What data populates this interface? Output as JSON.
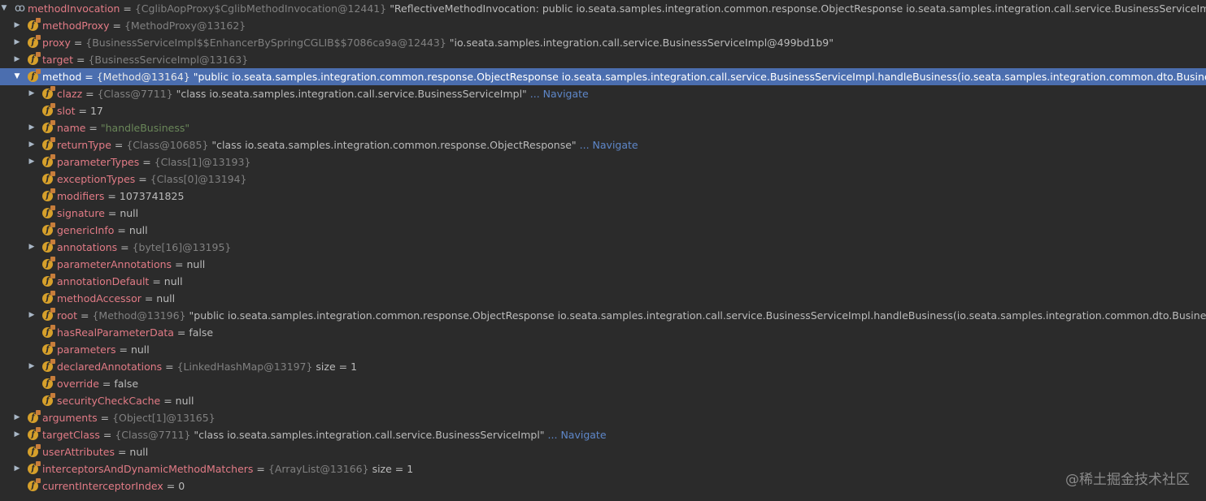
{
  "rows": [
    {
      "level": 0,
      "arrow": "down",
      "icon": "watch",
      "name": "methodInvocation",
      "type": "{CglibAopProxy$CglibMethodInvocation@12441}",
      "value": "\"ReflectiveMethodInvocation: public io.seata.samples.integration.common.response.ObjectResponse io.seata.samples.integration.call.service.BusinessServiceImpl.handleBusiness(io.seata.samples.integration.common.dto.BusinessDTO)\"",
      "nav": ""
    },
    {
      "level": 1,
      "arrow": "right",
      "icon": "field-lock",
      "name": "methodProxy",
      "type": "{MethodProxy@13162}",
      "value": "",
      "nav": ""
    },
    {
      "level": 1,
      "arrow": "right",
      "icon": "field-lock",
      "name": "proxy",
      "type": "{BusinessServiceImpl$$EnhancerBySpringCGLIB$$7086ca9a@12443}",
      "value": "\"io.seata.samples.integration.call.service.BusinessServiceImpl@499bd1b9\"",
      "nav": ""
    },
    {
      "level": 1,
      "arrow": "right",
      "icon": "field-lock",
      "name": "target",
      "type": "{BusinessServiceImpl@13163}",
      "value": "",
      "nav": ""
    },
    {
      "level": 1,
      "arrow": "down",
      "icon": "field-lock",
      "name": "method",
      "type": "{Method@13164}",
      "value": "\"public io.seata.samples.integration.common.response.ObjectResponse io.seata.samples.integration.call.service.BusinessServiceImpl.handleBusiness(io.seata.samples.integration.common.dto.BusinessDTO)\"",
      "nav": "",
      "selected": true
    },
    {
      "level": 2,
      "arrow": "right",
      "icon": "field-lock",
      "name": "clazz",
      "type": "{Class@7711}",
      "value": "\"class io.seata.samples.integration.call.service.BusinessServiceImpl\"",
      "nav": "... Navigate"
    },
    {
      "level": 2,
      "arrow": "",
      "icon": "field-lock",
      "name": "slot",
      "type": "",
      "value": "17",
      "nav": ""
    },
    {
      "level": 2,
      "arrow": "right",
      "icon": "field-lock",
      "name": "name",
      "type": "",
      "value": "",
      "str": "\"handleBusiness\"",
      "nav": ""
    },
    {
      "level": 2,
      "arrow": "right",
      "icon": "field-lock",
      "name": "returnType",
      "type": "{Class@10685}",
      "value": "\"class io.seata.samples.integration.common.response.ObjectResponse\"",
      "nav": "... Navigate"
    },
    {
      "level": 2,
      "arrow": "right",
      "icon": "field-lock",
      "name": "parameterTypes",
      "type": "{Class[1]@13193}",
      "value": "",
      "nav": ""
    },
    {
      "level": 2,
      "arrow": "",
      "icon": "field-lock",
      "name": "exceptionTypes",
      "type": "{Class[0]@13194}",
      "value": "",
      "nav": ""
    },
    {
      "level": 2,
      "arrow": "",
      "icon": "field-lock",
      "name": "modifiers",
      "type": "",
      "value": "1073741825",
      "nav": ""
    },
    {
      "level": 2,
      "arrow": "",
      "icon": "field-lock",
      "name": "signature",
      "type": "",
      "value": "null",
      "nav": ""
    },
    {
      "level": 2,
      "arrow": "",
      "icon": "field-lock",
      "name": "genericInfo",
      "type": "",
      "value": "null",
      "nav": ""
    },
    {
      "level": 2,
      "arrow": "right",
      "icon": "field-lock",
      "name": "annotations",
      "type": "{byte[16]@13195}",
      "value": "",
      "nav": ""
    },
    {
      "level": 2,
      "arrow": "",
      "icon": "field-lock",
      "name": "parameterAnnotations",
      "type": "",
      "value": "null",
      "nav": ""
    },
    {
      "level": 2,
      "arrow": "",
      "icon": "field-lock",
      "name": "annotationDefault",
      "type": "",
      "value": "null",
      "nav": ""
    },
    {
      "level": 2,
      "arrow": "",
      "icon": "field-lock",
      "name": "methodAccessor",
      "type": "",
      "value": "null",
      "nav": ""
    },
    {
      "level": 2,
      "arrow": "right",
      "icon": "field-lock",
      "name": "root",
      "type": "{Method@13196}",
      "value": "\"public io.seata.samples.integration.common.response.ObjectResponse io.seata.samples.integration.call.service.BusinessServiceImpl.handleBusiness(io.seata.samples.integration.common.dto.BusinessDTO)\"",
      "nav": ""
    },
    {
      "level": 2,
      "arrow": "",
      "icon": "field-lock",
      "name": "hasRealParameterData",
      "type": "",
      "value": "false",
      "nav": ""
    },
    {
      "level": 2,
      "arrow": "",
      "icon": "field-lock",
      "name": "parameters",
      "type": "",
      "value": "null",
      "nav": ""
    },
    {
      "level": 2,
      "arrow": "right",
      "icon": "field-lock",
      "name": "declaredAnnotations",
      "type": "{LinkedHashMap@13197}",
      "value": " size = 1",
      "nav": ""
    },
    {
      "level": 2,
      "arrow": "",
      "icon": "field-lock",
      "name": "override",
      "type": "",
      "value": "false",
      "nav": ""
    },
    {
      "level": 2,
      "arrow": "",
      "icon": "field-lock",
      "name": "securityCheckCache",
      "type": "",
      "value": "null",
      "nav": ""
    },
    {
      "level": 1,
      "arrow": "right",
      "icon": "field-lock",
      "name": "arguments",
      "type": "{Object[1]@13165}",
      "value": "",
      "nav": ""
    },
    {
      "level": 1,
      "arrow": "right",
      "icon": "field-lock",
      "name": "targetClass",
      "type": "{Class@7711}",
      "value": "\"class io.seata.samples.integration.call.service.BusinessServiceImpl\"",
      "nav": "... Navigate"
    },
    {
      "level": 1,
      "arrow": "",
      "icon": "field-lock",
      "name": "userAttributes",
      "type": "",
      "value": "null",
      "nav": ""
    },
    {
      "level": 1,
      "arrow": "right",
      "icon": "field-lock",
      "name": "interceptorsAndDynamicMethodMatchers",
      "type": "{ArrayList@13166}",
      "value": " size = 1",
      "nav": ""
    },
    {
      "level": 1,
      "arrow": "",
      "icon": "field-lock",
      "name": "currentInterceptorIndex",
      "type": "",
      "value": "0",
      "nav": ""
    }
  ],
  "watermark": "@稀土掘金技术社区",
  "colors": {
    "background": "#2b2b2b",
    "selection": "#4b6eaf",
    "field_name": "#e27b86",
    "type_info": "#808080",
    "string_value": "#6a8759",
    "navigate_link": "#5e87c9",
    "field_icon": "#d6a02b"
  }
}
